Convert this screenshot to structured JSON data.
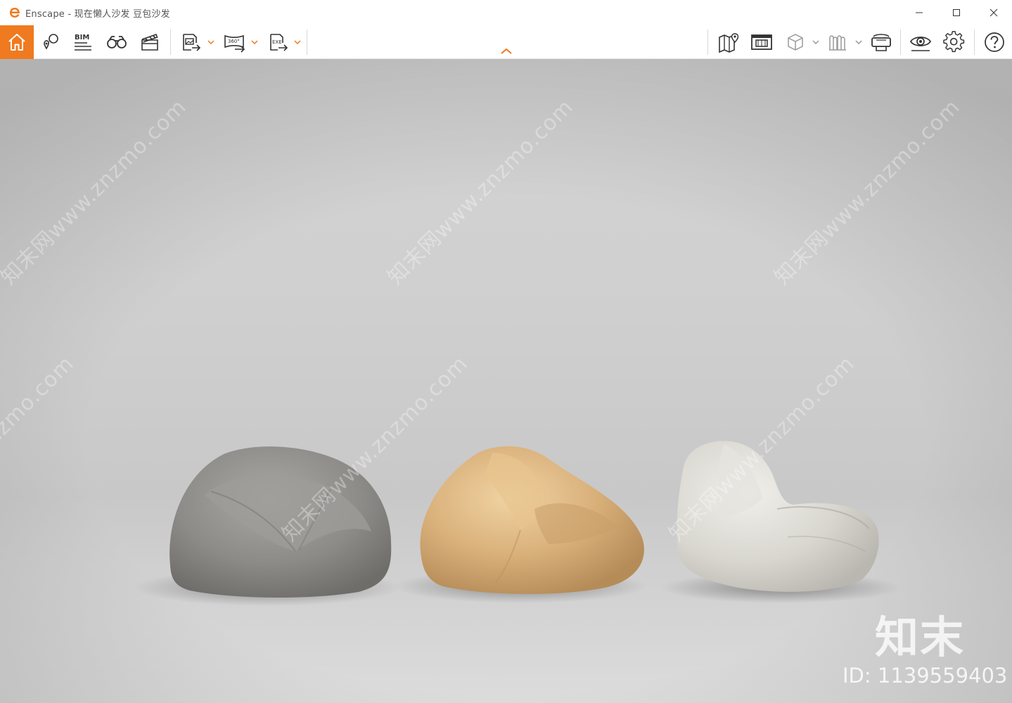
{
  "window": {
    "title": "Enscape - 现在懒人沙发 豆包沙发",
    "controls": {
      "minimize": "minimize-icon",
      "maximize": "maximize-icon",
      "close": "close-icon"
    }
  },
  "colors": {
    "accent": "#f07a1f",
    "icon": "#333333",
    "icon_disabled": "#9a9a9a",
    "background": "#d0d0d0"
  },
  "toolbar": {
    "left": [
      {
        "name": "home",
        "icon": "home-icon",
        "active": true
      },
      {
        "name": "views",
        "icon": "pin-icon"
      },
      {
        "name": "bim",
        "icon": "bim-icon",
        "label": "BIM"
      },
      {
        "name": "binoculars",
        "icon": "binoculars-icon"
      },
      {
        "name": "video-editor",
        "icon": "clapperboard-icon"
      },
      {
        "name": "export-image",
        "icon": "image-export-icon",
        "dropdown": true
      },
      {
        "name": "export-panorama",
        "icon": "panorama-export-icon",
        "label": "360°",
        "dropdown": true
      },
      {
        "name": "export-exe",
        "icon": "exe-export-icon",
        "label": "EXE",
        "dropdown": true
      }
    ],
    "right": [
      {
        "name": "map",
        "icon": "map-icon"
      },
      {
        "name": "screen",
        "icon": "screen-icon"
      },
      {
        "name": "cube",
        "icon": "cube-icon",
        "dropdown": true,
        "disabled": true
      },
      {
        "name": "ar",
        "icon": "ar-icon",
        "dropdown": true,
        "disabled": true
      },
      {
        "name": "vr-headset",
        "icon": "vr-headset-icon"
      },
      {
        "name": "visual-settings",
        "icon": "eye-icon"
      },
      {
        "name": "settings",
        "icon": "gear-icon"
      },
      {
        "name": "help",
        "icon": "help-icon"
      }
    ],
    "collapse_toggle": "chevron-up-icon"
  },
  "viewport": {
    "watermark_text": "知末网www.znzmo.com",
    "brand": "知末",
    "id_label": "ID: 1139559403",
    "objects": [
      {
        "name": "grey-beanbag",
        "color": "#8f8e8b"
      },
      {
        "name": "yellow-beanbag",
        "color": "#d8b27e"
      },
      {
        "name": "white-lounger",
        "color": "#d6d4cd"
      }
    ]
  }
}
